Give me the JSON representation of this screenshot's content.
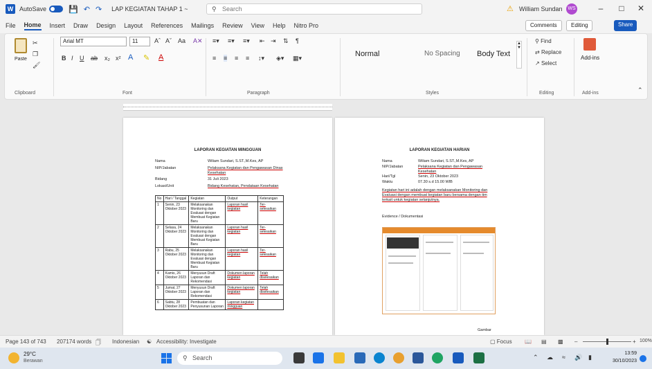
{
  "titlebar": {
    "autosave": "AutoSave",
    "toggle_state": "Off",
    "doc_name": "LAP KEGIATAN TAHAP 1 ~",
    "search_placeholder": "Search",
    "user_name": "William Sundan",
    "avatar_initials": "WS"
  },
  "menu": {
    "items": [
      "File",
      "Home",
      "Insert",
      "Draw",
      "Design",
      "Layout",
      "References",
      "Mailings",
      "Review",
      "View",
      "Help",
      "Nitro Pro"
    ],
    "comments": "Comments",
    "editing": "Editing",
    "share": "Share"
  },
  "ribbon": {
    "paste": "Paste",
    "font_name": "Arial MT",
    "font_size": "11",
    "styles": [
      "Normal",
      "No Spacing",
      "Body Text"
    ],
    "editing": [
      "Find",
      "Replace",
      "Select"
    ],
    "addins": "Add-ins",
    "groups": [
      "Clipboard",
      "Font",
      "Paragraph",
      "Styles",
      "Editing",
      "Add-ins"
    ]
  },
  "page1": {
    "title": "LAPORAN KEGIATAN MINGGUAN",
    "fields": [
      {
        "label": "Nama",
        "value": "Wiliam Sundari, S.ST.,M.Kes, AP"
      },
      {
        "label": "NIP/Jabatan",
        "value": "Pelaksana Kegiatan dan Pengawasan Dinas Kesehatan"
      },
      {
        "label": "Bidang",
        "value": "31 Juli 2023"
      },
      {
        "label": "Lokasi/Unit",
        "value": "Bidang Kesehatan, Pendataan Kesehatan"
      }
    ],
    "table_headers": [
      "No",
      "Hari / Tanggal",
      "Kegiatan",
      "Output",
      "Keterangan"
    ],
    "table_rows": [
      [
        "1",
        "Senin, 23 Oktober 2023",
        "Melaksanakan Monitoring dan Evaluasi dengan Membuat Kegiatan Baru",
        "Laporan hasil kegiatan",
        "Ter- selesaikan"
      ],
      [
        "2",
        "Selasa, 24 Oktober 2023",
        "Melaksanakan Monitoring dan Evaluasi dengan Membuat Kegiatan Baru",
        "Laporan hasil kegiatan",
        "Ter- selesaikan"
      ],
      [
        "3",
        "Rabu, 25 Oktober 2023",
        "Melaksanakan Monitoring dan Evaluasi dengan Membuat Kegiatan Baru",
        "Laporan hasil kegiatan",
        "Ter- selesaikan"
      ],
      [
        "4",
        "Kamis, 26 Oktober 2023",
        "Menyusun Draft Laporan dan Rekomendasi",
        "Dokumen laporan kegiatan",
        "Telah diselesaikan"
      ],
      [
        "5",
        "Jumat, 27 Oktober 2023",
        "Menyusun Draft Laporan dan Rekomendasi",
        "Dokumen laporan kegiatan",
        "Telah diselesaikan"
      ],
      [
        "6",
        "Sabtu, 28 Oktober 2023",
        "Pembuatan dan Penyusunan Laporan",
        "Laporan kegiatan mingguan",
        ""
      ]
    ]
  },
  "page2": {
    "title": "LAPORAN KEGIATAN HARIAN",
    "fields": [
      {
        "label": "Nama",
        "value": "Wiliam Sundari, S.ST.,M.Kes, AP"
      },
      {
        "label": "NIP/Jabatan",
        "value": "Pelaksana Kegiatan dan Pengawasan Kesehatan"
      },
      {
        "label": "Hari/Tgl",
        "value": "Senin, 23 Oktober 2023"
      },
      {
        "label": "Waktu",
        "value": "07.30 s.d 15.00 WIB"
      }
    ],
    "paragraph": "Kegiatan hari ini adalah dengan melaksanakan Monitoring dan Evaluasi dengan membuat kegiatan baru bersama dengan tim terkait untuk kegiatan selanjutnya.",
    "evidence": "Evidence / Dokumentasi",
    "caption": "Gambar"
  },
  "statusbar": {
    "page": "Page 143 of 743",
    "words": "207174 words",
    "language": "Indonesian",
    "accessibility": "Accessibility: Investigate",
    "focus": "Focus",
    "zoom": "100%"
  },
  "taskbar": {
    "temp": "29°C",
    "weather": "Berawan",
    "search": "Search",
    "time": "13:59",
    "date": "30/10/2023"
  }
}
